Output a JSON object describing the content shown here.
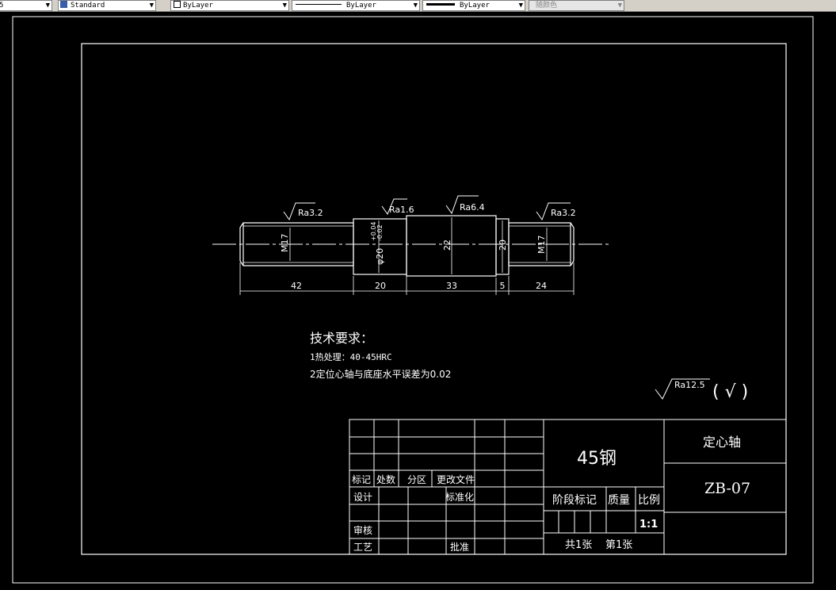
{
  "toolbar": {
    "partial_left": "5",
    "text_style": "Standard",
    "layer": "ByLayer",
    "linetype": "ByLayer",
    "lineweight": "ByLayer",
    "color": "随颜色"
  },
  "drawing": {
    "roughness": {
      "r1": "Ra3.2",
      "r2": "Ra1.6",
      "r3": "Ra6.4",
      "r4": "Ra3.2"
    },
    "diameters": {
      "d1": "M17",
      "d2": "φ20",
      "d2_tol_upper": "+0.04",
      "d2_tol_lower": "-0.02",
      "d3": "22",
      "d4": "20",
      "d5": "M17"
    },
    "lengths": [
      "42",
      "20",
      "33",
      "5",
      "24"
    ],
    "tech": {
      "heading": "技术要求：",
      "line1": "1热处理：40-45HRC",
      "line2": "2定位心轴与底座水平误差为0.02"
    },
    "general_roughness": {
      "label": "Ra12.5",
      "mark": "( √ )"
    }
  },
  "title_block": {
    "material": "45钢",
    "part_name": "定心轴",
    "drawing_no": "ZB-07",
    "row_headers": {
      "mark": "标记",
      "count": "处数",
      "zone": "分区",
      "change_doc": "更改文件"
    },
    "design": "设计",
    "standardize": "标准化",
    "review": "审核",
    "process": "工艺",
    "approve": "批准",
    "stage_mark": "阶段标记",
    "mass": "质量",
    "scale_label": "比例",
    "scale_value": "1:1",
    "total_sheets": "共1张",
    "sheet_no": "第1张"
  }
}
